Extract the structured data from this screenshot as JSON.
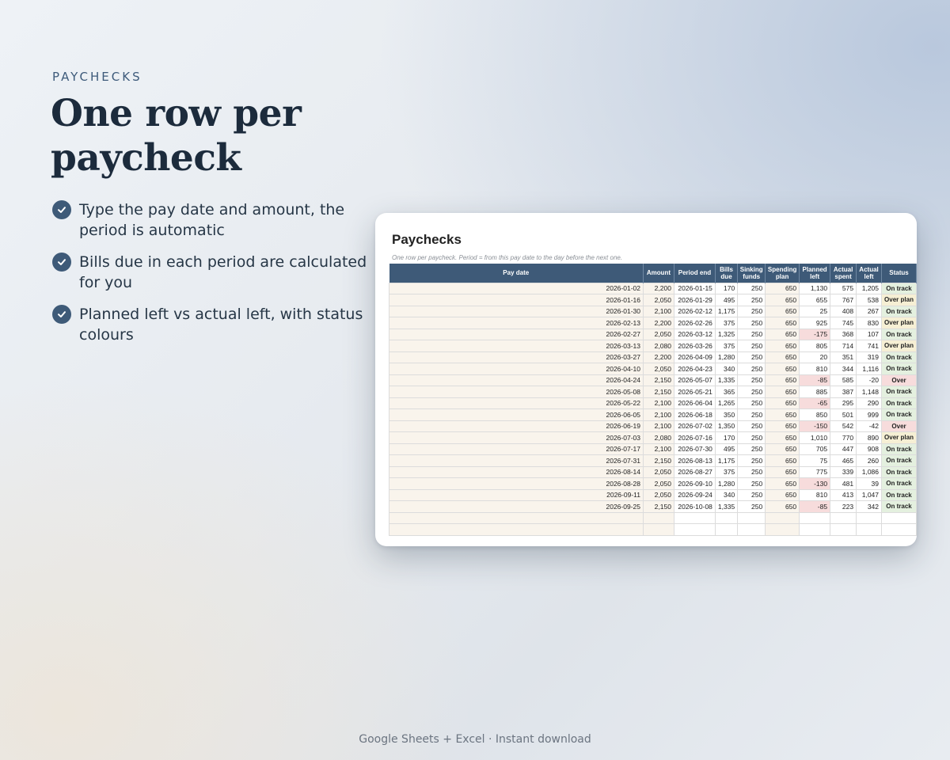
{
  "hero": {
    "eyebrow": "PAYCHECKS",
    "headline": "One row per paycheck",
    "bullets": [
      "Type the pay date and amount, the period is automatic",
      "Bills due in each period are calculated for you",
      "Planned left vs actual left, with status colours"
    ]
  },
  "sheet": {
    "title": "Paychecks",
    "subtitle": "One row per paycheck. Period = from this pay date to the day before the next one.",
    "columns": [
      "Pay date",
      "Amount",
      "Period end",
      "Bills due",
      "Sinking funds",
      "Spending plan",
      "Planned left",
      "Actual spent",
      "Actual left",
      "Status"
    ],
    "rows": [
      [
        "2026-01-02",
        "2,200",
        "2026-01-15",
        "170",
        "250",
        "650",
        "1,130",
        "575",
        "1,205",
        "On track"
      ],
      [
        "2026-01-16",
        "2,050",
        "2026-01-29",
        "495",
        "250",
        "650",
        "655",
        "767",
        "538",
        "Over plan"
      ],
      [
        "2026-01-30",
        "2,100",
        "2026-02-12",
        "1,175",
        "250",
        "650",
        "25",
        "408",
        "267",
        "On track"
      ],
      [
        "2026-02-13",
        "2,200",
        "2026-02-26",
        "375",
        "250",
        "650",
        "925",
        "745",
        "830",
        "Over plan"
      ],
      [
        "2026-02-27",
        "2,050",
        "2026-03-12",
        "1,325",
        "250",
        "650",
        "-175",
        "368",
        "107",
        "On track"
      ],
      [
        "2026-03-13",
        "2,080",
        "2026-03-26",
        "375",
        "250",
        "650",
        "805",
        "714",
        "741",
        "Over plan"
      ],
      [
        "2026-03-27",
        "2,200",
        "2026-04-09",
        "1,280",
        "250",
        "650",
        "20",
        "351",
        "319",
        "On track"
      ],
      [
        "2026-04-10",
        "2,050",
        "2026-04-23",
        "340",
        "250",
        "650",
        "810",
        "344",
        "1,116",
        "On track"
      ],
      [
        "2026-04-24",
        "2,150",
        "2026-05-07",
        "1,335",
        "250",
        "650",
        "-85",
        "585",
        "-20",
        "Over"
      ],
      [
        "2026-05-08",
        "2,150",
        "2026-05-21",
        "365",
        "250",
        "650",
        "885",
        "387",
        "1,148",
        "On track"
      ],
      [
        "2026-05-22",
        "2,100",
        "2026-06-04",
        "1,265",
        "250",
        "650",
        "-65",
        "295",
        "290",
        "On track"
      ],
      [
        "2026-06-05",
        "2,100",
        "2026-06-18",
        "350",
        "250",
        "650",
        "850",
        "501",
        "999",
        "On track"
      ],
      [
        "2026-06-19",
        "2,100",
        "2026-07-02",
        "1,350",
        "250",
        "650",
        "-150",
        "542",
        "-42",
        "Over"
      ],
      [
        "2026-07-03",
        "2,080",
        "2026-07-16",
        "170",
        "250",
        "650",
        "1,010",
        "770",
        "890",
        "Over plan"
      ],
      [
        "2026-07-17",
        "2,100",
        "2026-07-30",
        "495",
        "250",
        "650",
        "705",
        "447",
        "908",
        "On track"
      ],
      [
        "2026-07-31",
        "2,150",
        "2026-08-13",
        "1,175",
        "250",
        "650",
        "75",
        "465",
        "260",
        "On track"
      ],
      [
        "2026-08-14",
        "2,050",
        "2026-08-27",
        "375",
        "250",
        "650",
        "775",
        "339",
        "1,086",
        "On track"
      ],
      [
        "2026-08-28",
        "2,050",
        "2026-09-10",
        "1,280",
        "250",
        "650",
        "-130",
        "481",
        "39",
        "On track"
      ],
      [
        "2026-09-11",
        "2,050",
        "2026-09-24",
        "340",
        "250",
        "650",
        "810",
        "413",
        "1,047",
        "On track"
      ],
      [
        "2026-09-25",
        "2,150",
        "2026-10-08",
        "1,335",
        "250",
        "650",
        "-85",
        "223",
        "342",
        "On track"
      ]
    ],
    "colors": {
      "header": "#3e5a78",
      "input": "#f9f4ec",
      "negative": "#f7dcdc",
      "on_track": "#e4f0df",
      "over_plan": "#f6efd4"
    }
  },
  "footer": {
    "text": "Google Sheets + Excel  ·  Instant download"
  },
  "icons": {
    "bullet": "check-circle-icon"
  }
}
